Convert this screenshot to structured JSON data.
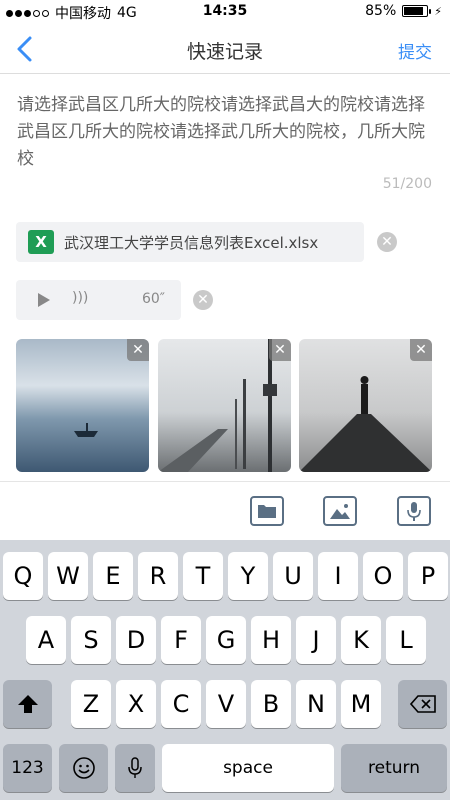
{
  "status_bar": {
    "carrier": "中国移动",
    "network": "4G",
    "time": "14:35",
    "battery": "85%",
    "battery_level": 0.85
  },
  "nav": {
    "title": "快速记录",
    "submit_label": "提交"
  },
  "note": {
    "text": "请选择武昌区几所大的院校请选择武昌大的院校请选择武昌区几所大的院校请选择武几所大的院校，几所大院校",
    "counter": "51/200"
  },
  "attachment": {
    "icon_letter": "X",
    "file_name": "武汉理工大学学员信息列表Excel.xlsx"
  },
  "voice": {
    "duration": "60″"
  },
  "photos": [
    {
      "name": "lake-boat"
    },
    {
      "name": "railway"
    },
    {
      "name": "pier-person"
    }
  ],
  "toolbar": {
    "icons": [
      "folder-icon",
      "image-icon",
      "microphone-icon"
    ]
  },
  "keyboard": {
    "row1": [
      "Q",
      "W",
      "E",
      "R",
      "T",
      "Y",
      "U",
      "I",
      "O",
      "P"
    ],
    "row2": [
      "A",
      "S",
      "D",
      "F",
      "G",
      "H",
      "J",
      "K",
      "L"
    ],
    "row3": [
      "Z",
      "X",
      "C",
      "V",
      "B",
      "N",
      "M"
    ],
    "numbers_label": "123",
    "space_label": "space",
    "return_label": "return"
  },
  "colors": {
    "accent": "#3a8ef6",
    "excel": "#1f9d55"
  }
}
